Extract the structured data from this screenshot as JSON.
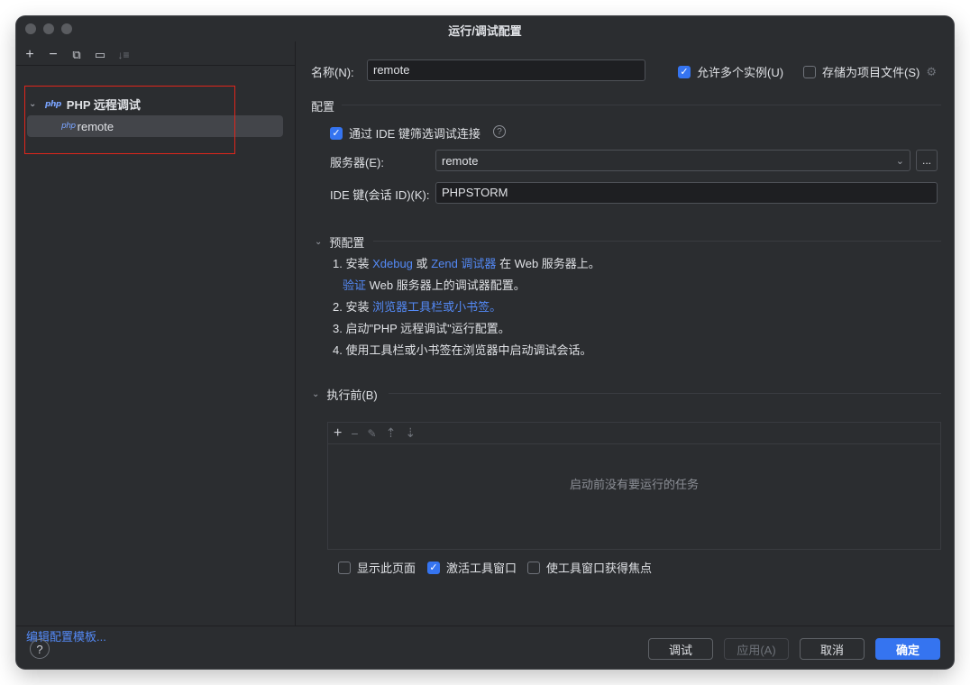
{
  "window": {
    "title": "运行/调试配置"
  },
  "left_panel": {
    "toolbar": [
      "add-icon",
      "remove-icon",
      "copy-icon",
      "new-folder-icon",
      "sort-icon"
    ],
    "tree_group_label": "PHP 远程调试",
    "tree_item_label": "remote",
    "php_icon_text": "php",
    "edit_templates": "编辑配置模板..."
  },
  "form": {
    "name_label": "名称(N):",
    "name_value": "remote",
    "allow_multiple": {
      "label": "允许多个实例(U)",
      "checked": true
    },
    "store_as_project": {
      "label": "存储为项目文件(S)",
      "checked": false
    },
    "config_section": "配置",
    "filter_by_ide_key": {
      "label": "通过 IDE 键筛选调试连接",
      "checked": true
    },
    "server_label": "服务器(E):",
    "server_value": "remote",
    "ide_key_label": "IDE 键(会话 ID)(K):",
    "ide_key_value": "PHPSTORM",
    "dots_label": "..."
  },
  "preconfig": {
    "title": "预配置",
    "step1_prefix": "1. 安装",
    "step1_link1": "Xdebug",
    "step1_or": "或",
    "step1_link2": "Zend 调试器",
    "step1_suffix": "在 Web 服务器上。",
    "verify_link": "验证",
    "verify_suffix": "Web 服务器上的调试器配置。",
    "step2_prefix": "2. 安装",
    "step2_link": "浏览器工具栏或小书签。",
    "step3": "3. 启动\"PHP 远程调试\"运行配置。",
    "step4": "4. 使用工具栏或小书签在浏览器中启动调试会话。"
  },
  "before_launch": {
    "title": "执行前(B)",
    "empty_text": "启动前没有要运行的任务",
    "show_page": {
      "label": "显示此页面",
      "checked": false
    },
    "activate_tool_window": {
      "label": "激活工具窗口",
      "checked": true
    },
    "focus_tool_window": {
      "label": "使工具窗口获得焦点",
      "checked": false
    }
  },
  "buttons": {
    "debug": "调试",
    "apply": "应用(A)",
    "cancel": "取消",
    "ok": "确定",
    "help": "?"
  },
  "colors": {
    "accent": "#3574f0",
    "link": "#548af7",
    "highlight_box": "#e0251b"
  }
}
